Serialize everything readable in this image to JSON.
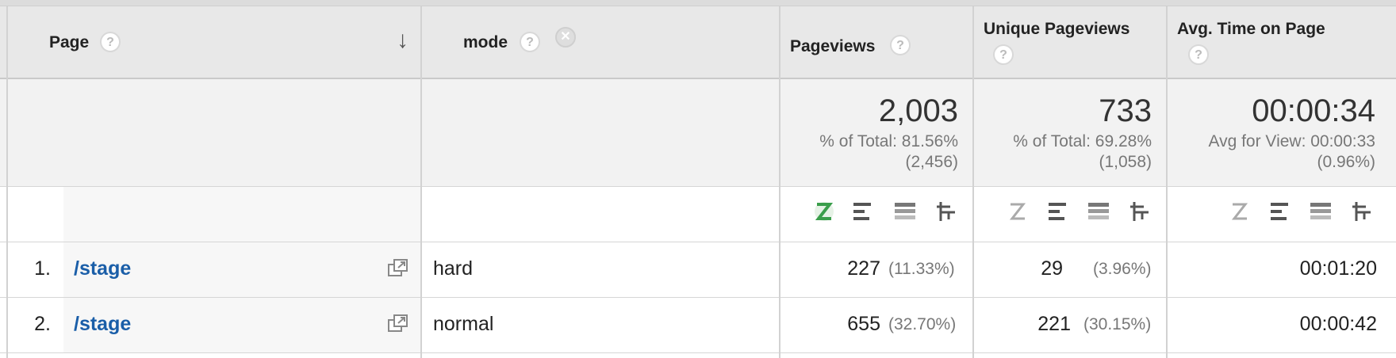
{
  "columns": {
    "page": "Page",
    "mode": "mode",
    "pageviews": "Pageviews",
    "unique_pageviews": "Unique Pageviews",
    "avg_time": "Avg. Time on Page"
  },
  "help_glyph": "?",
  "remove_glyph": "✕",
  "sort_glyph": "↓",
  "summary": {
    "pageviews": {
      "value": "2,003",
      "line1": "% of Total: 81.56%",
      "line2": "(2,456)"
    },
    "unique_pageviews": {
      "value": "733",
      "line1": "% of Total: 69.28%",
      "line2": "(1,058)"
    },
    "avg_time": {
      "value": "00:00:34",
      "line1": "Avg for View: 00:00:33",
      "line2": "(0.96%)"
    }
  },
  "rows": [
    {
      "index": "1.",
      "page": "/stage",
      "mode": "hard",
      "pageviews": "227",
      "pageviews_pct": "(11.33%)",
      "unique": "29",
      "unique_pct": "(3.96%)",
      "avg_time": "00:01:20"
    },
    {
      "index": "2.",
      "page": "/stage",
      "mode": "normal",
      "pageviews": "655",
      "pageviews_pct": "(32.70%)",
      "unique": "221",
      "unique_pct": "(30.15%)",
      "avg_time": "00:00:42"
    }
  ],
  "colors": {
    "link": "#1a5ea8",
    "active_icon": "#3a9e4b",
    "header_bg": "#e8e8e8"
  }
}
